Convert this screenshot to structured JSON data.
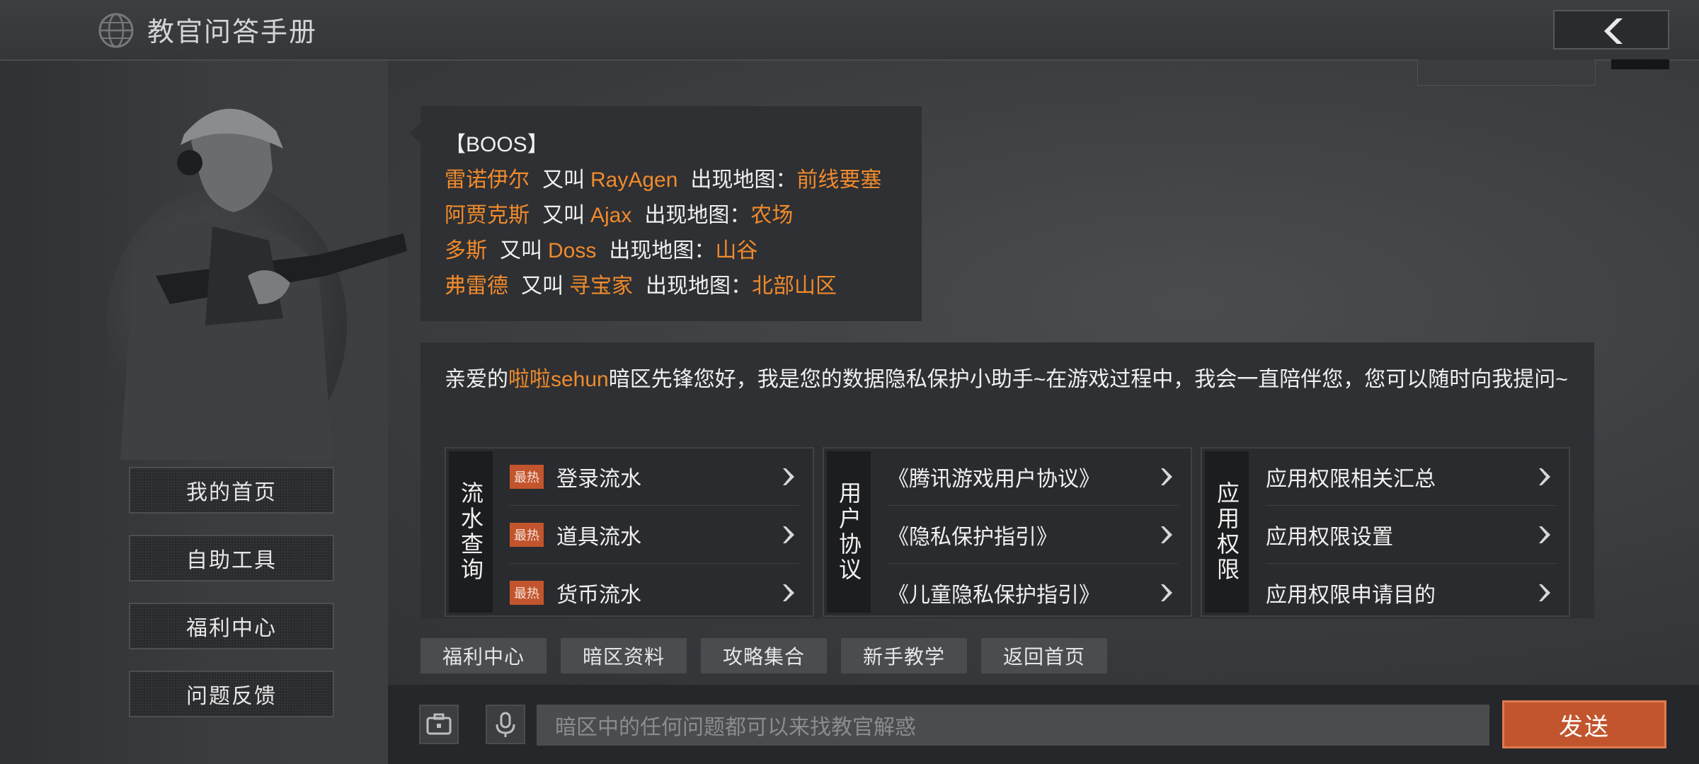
{
  "header": {
    "title": "教官问答手册",
    "back_icon": "chevron-left-icon"
  },
  "sidebar": {
    "items": [
      {
        "label": "我的首页"
      },
      {
        "label": "自助工具"
      },
      {
        "label": "福利中心"
      },
      {
        "label": "问题反馈"
      }
    ]
  },
  "boss": {
    "heading": "【BOOS】",
    "rows": [
      {
        "name": "雷诺伊尔",
        "aka_label": "又叫",
        "alias": "RayAgen",
        "map_label": "出现地图：",
        "map": "前线要塞"
      },
      {
        "name": "阿贾克斯",
        "aka_label": "又叫",
        "alias": "Ajax",
        "map_label": "出现地图：",
        "map": "农场"
      },
      {
        "name": "多斯",
        "aka_label": "又叫",
        "alias": "Doss",
        "map_label": "出现地图：",
        "map": "山谷"
      },
      {
        "name": "弗雷德",
        "aka_label": "又叫",
        "alias": "寻宝家",
        "map_label": "出现地图：",
        "map": "北部山区"
      }
    ]
  },
  "assistant": {
    "greeting_prefix": "亲爱的",
    "username": "啦啦sehun",
    "greeting_rest": "暗区先锋您好，我是您的数据隐私保护小助手~在游戏过程中，我会一直陪伴您，您可以随时向我提问~",
    "groups": [
      {
        "label": "流水查询",
        "items": [
          {
            "badge": "最热",
            "text": "登录流水"
          },
          {
            "badge": "最热",
            "text": "道具流水"
          },
          {
            "badge": "最热",
            "text": "货币流水"
          }
        ]
      },
      {
        "label": "用户协议",
        "items": [
          {
            "text": "《腾讯游戏用户协议》"
          },
          {
            "text": "《隐私保护指引》"
          },
          {
            "text": "《儿童隐私保护指引》"
          }
        ]
      },
      {
        "label": "应用权限",
        "items": [
          {
            "text": "应用权限相关汇总"
          },
          {
            "text": "应用权限设置"
          },
          {
            "text": "应用权限申请目的"
          }
        ]
      }
    ]
  },
  "quick_tabs": [
    "福利中心",
    "暗区资料",
    "攻略集合",
    "新手教学",
    "返回首页"
  ],
  "input": {
    "placeholder": "暗区中的任何问题都可以来找教官解惑",
    "send_label": "发送"
  },
  "colors": {
    "accent_orange": "#f08a2c",
    "send_button": "#c2552d",
    "hot_badge": "#c2552d"
  }
}
